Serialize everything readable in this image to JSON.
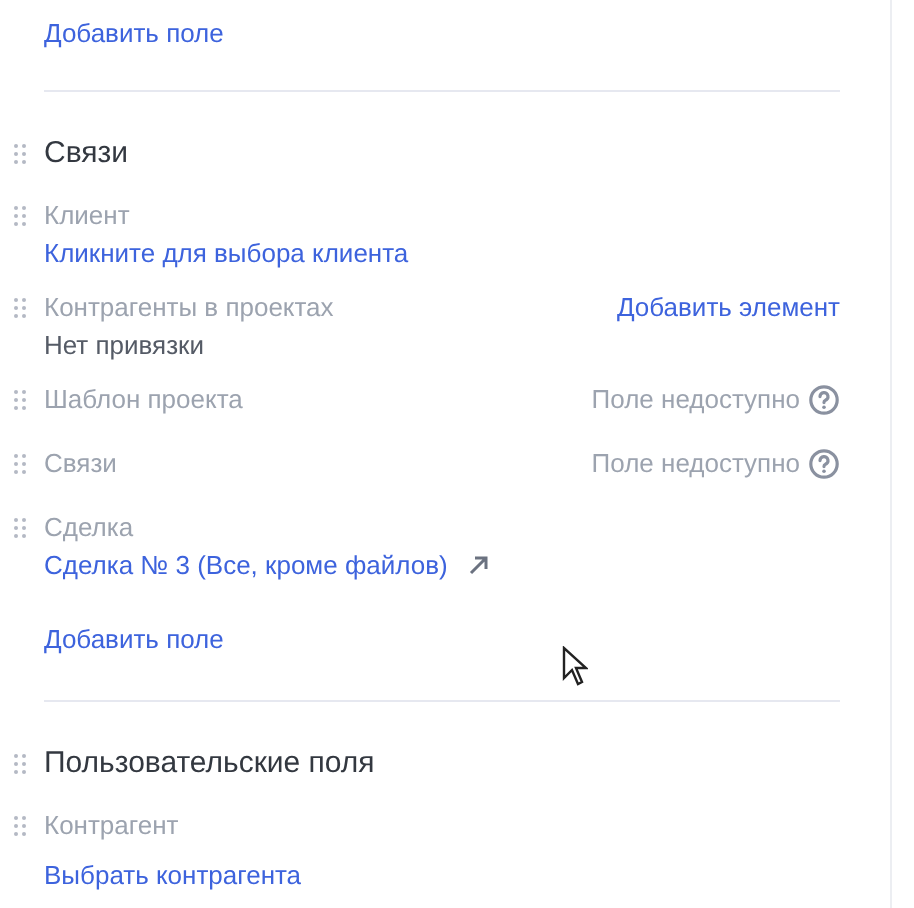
{
  "top_add_field": "Добавить поле",
  "sections": [
    {
      "title": "Связи",
      "fields": [
        {
          "kind": "link",
          "label": "Клиент",
          "value": "Кликните для выбора клиента"
        },
        {
          "kind": "text",
          "label": "Контрагенты в проектах",
          "action": "Добавить элемент",
          "value": "Нет привязки"
        },
        {
          "kind": "unavailable",
          "label": "Шаблон проекта",
          "note": "Поле недоступно"
        },
        {
          "kind": "unavailable",
          "label": "Связи",
          "note": "Поле недоступно"
        },
        {
          "kind": "link",
          "label": "Сделка",
          "value": "Сделка № 3 (Все, кроме файлов)",
          "external": true
        }
      ],
      "add_field": "Добавить поле"
    },
    {
      "title": "Пользовательские поля",
      "fields": [
        {
          "kind": "action",
          "label": "Контрагент",
          "value": "Выбрать контрагента"
        }
      ]
    }
  ]
}
